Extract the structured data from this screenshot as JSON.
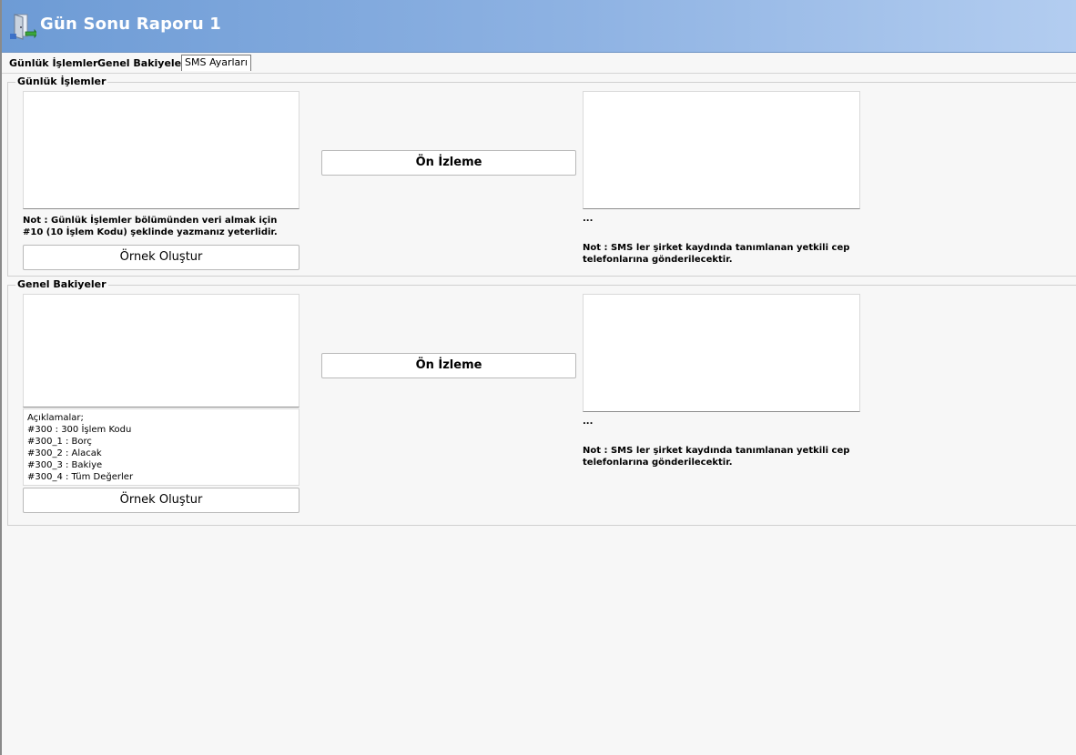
{
  "window": {
    "title": "Gün Sonu Raporu 1",
    "icon": "door-exit-icon"
  },
  "tabs": [
    {
      "label": "Günlük İşlemler",
      "active": false
    },
    {
      "label": "Genel Bakiyeler",
      "active": false
    },
    {
      "label": "SMS Ayarları",
      "active": true
    }
  ],
  "daily": {
    "legend": "Günlük İşlemler",
    "template_value": "",
    "note": "Not : Günlük İşlemler bölümünden veri almak için #10 (10 İşlem Kodu) şeklinde yazmanız yeterlidir.",
    "example_button": "Örnek Oluştur",
    "preview_button": "Ön İzleme",
    "preview_value": "",
    "ellipsis": "...",
    "sms_note": "Not : SMS ler şirket kaydında tanımlanan yetkili cep telefonlarına gönderilecektir."
  },
  "balances": {
    "legend": "Genel Bakiyeler",
    "template_value": "",
    "descriptions": [
      "Açıklamalar;",
      "#300 : 300 İşlem Kodu",
      "#300_1 : Borç",
      "#300_2 : Alacak",
      "#300_3 : Bakiye",
      "#300_4 : Tüm Değerler"
    ],
    "example_button": "Örnek Oluştur",
    "preview_button": "Ön İzleme",
    "preview_value": "",
    "ellipsis": "...",
    "sms_note": "Not : SMS ler şirket kaydında tanımlanan yetkili cep telefonlarına gönderilecektir."
  }
}
